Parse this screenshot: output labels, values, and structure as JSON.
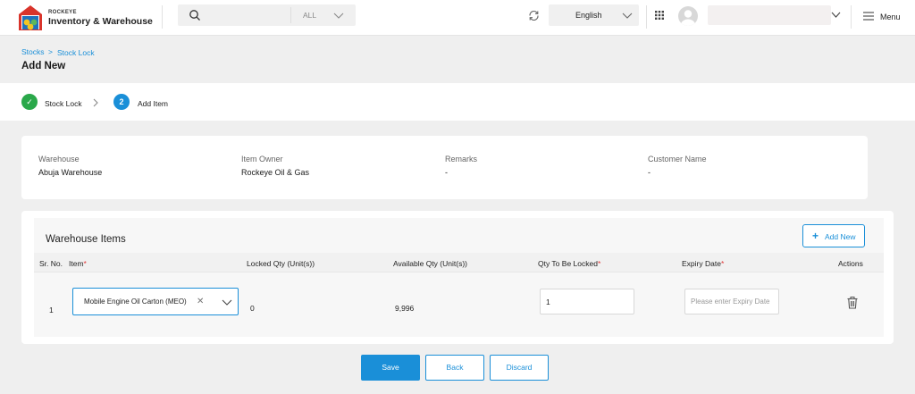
{
  "brand": {
    "small": "ROCKEYE",
    "title": "Inventory & Warehouse"
  },
  "header": {
    "search_filter": "ALL",
    "language": "English",
    "menu_label": "Menu"
  },
  "breadcrumb": {
    "root": "Stocks",
    "separator": ">",
    "current": "Stock Lock"
  },
  "page": {
    "title": "Add New"
  },
  "steps": [
    {
      "number": "✓",
      "label": "Stock Lock",
      "state": "done"
    },
    {
      "number": "2",
      "label": "Add Item",
      "state": "active"
    }
  ],
  "details": {
    "warehouse": {
      "label": "Warehouse",
      "value": "Abuja Warehouse"
    },
    "item_owner": {
      "label": "Item Owner",
      "value": "Rockeye Oil & Gas"
    },
    "remarks": {
      "label": "Remarks",
      "value": "-"
    },
    "customer_name": {
      "label": "Customer Name",
      "value": "-"
    }
  },
  "warehouse_items": {
    "title": "Warehouse Items",
    "add_button": "Add New",
    "columns": {
      "sr_no": "Sr. No.",
      "item": "Item",
      "locked_qty": "Locked Qty (Unit(s))",
      "available_qty": "Available Qty (Unit(s))",
      "qty_to_lock": "Qty To Be Locked",
      "expiry_date": "Expiry Date",
      "actions": "Actions"
    },
    "required_mark": "*",
    "rows": [
      {
        "sr_no": "1",
        "item": "Mobile Engine Oil Carton (MEO)",
        "locked_qty": "0",
        "available_qty": "9,996",
        "qty_to_lock": "1",
        "expiry_placeholder": "Please enter Expiry Date"
      }
    ]
  },
  "actions": {
    "save": "Save",
    "back": "Back",
    "discard": "Discard"
  },
  "colors": {
    "primary": "#1a8fd8",
    "success": "#2aa84a",
    "required": "#e23a3a"
  }
}
